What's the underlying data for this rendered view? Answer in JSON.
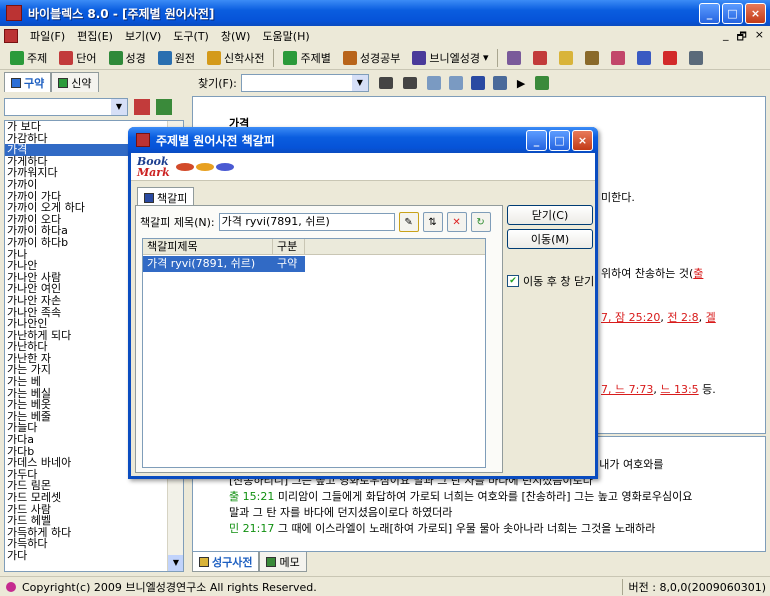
{
  "window": {
    "title": "바이블렉스 8.0 - [주제별 원어사전]"
  },
  "menu": [
    "파일(F)",
    "편집(E)",
    "보기(V)",
    "도구(T)",
    "창(W)",
    "도움말(H)"
  ],
  "mdi": {
    "minimize": "_",
    "restore": "🗗",
    "close": "×"
  },
  "toolbar": {
    "items": [
      "주제",
      "단어",
      "성경",
      "원전",
      "신학사전",
      "주제별",
      "성경공부",
      "브니엘성경"
    ]
  },
  "sidebar": {
    "tabs": [
      "구약",
      "신약"
    ],
    "words": [
      "가 보다",
      "가감하다",
      "가격",
      "가게하다",
      "가까워지다",
      "가까이",
      "가까이 가다",
      "가까이 오게 하다",
      "가까이 오다",
      "가까이 하다a",
      "가까이 하다b",
      "가나",
      "가나안",
      "가나안 사람",
      "가나안 여인",
      "가나안 자손",
      "가나안 족속",
      "가나안인",
      "가난하게 되다",
      "가난하다",
      "가난한 자",
      "가는 가지",
      "가는 베",
      "가는 베실",
      "가는 베옷",
      "가는 베줄",
      "가늘다",
      "가다a",
      "가다b",
      "가데스 바네아",
      "가두다",
      "가드 림몬",
      "가드 모레셋",
      "가드 사람",
      "가드 헤벨",
      "가득하게 하다",
      "가득하다",
      "가다"
    ],
    "selected_index": 2
  },
  "find": {
    "label": "찾기(F):"
  },
  "content": {
    "heading": "가격",
    "fragments": [
      {
        "text": "미한다.",
        "color": "black"
      },
      {
        "text": "위하여 찬송하는 것(",
        "color": "black"
      },
      {
        "text": "출",
        "color": "red"
      },
      {
        "text": "7, ",
        "color": "red"
      },
      {
        "text": "잠 25:20",
        "color": "red"
      },
      {
        "text": ", ",
        "color": "black"
      },
      {
        "text": "전 2:8",
        "color": "red"
      },
      {
        "text": ", ",
        "color": "black"
      },
      {
        "text": "겔",
        "color": "red"
      },
      {
        "text": "7, ",
        "color": "red"
      },
      {
        "text": "느 7:73",
        "color": "red"
      },
      {
        "text": ", ",
        "color": "black"
      },
      {
        "text": "느 13:5",
        "color": "red"
      },
      {
        "text": " 등.",
        "color": "black"
      }
    ]
  },
  "lower": {
    "lines": [
      {
        "ref": "",
        "text": "                                                                                                       불렀으되 내가 여호와를"
      },
      {
        "ref": "출 15:1",
        "text": " 이 때에 모세와 이스라엘 자손이 이 노래로 여호와께 노래하니 일렀으되 내가 여호와를"
      },
      {
        "ref": "",
        "text": "[찬송하리니] 그는 높고 영화로우심이요 말과 그 탄 자를 바다에 던지셨음이로다"
      },
      {
        "ref": "출 15:21",
        "text": " 미리암이 그들에게 화답하여 가로되 너희는 여호와를 [찬송하라] 그는 높고 영화로우심이요"
      },
      {
        "ref": "",
        "text": "말과 그 탄 자를 바다에 던지셨음이로다 하였더라"
      },
      {
        "ref": "민 21:17",
        "text": " 그 때에 이스라엘이 노래[하여 가로되] 우물 물아 솟아나라 너희는 그것을 노래하라"
      }
    ]
  },
  "bottom_tabs": [
    "성구사전",
    "메모"
  ],
  "status": {
    "left": "Copyright(c) 2009 브니엘성경연구소 All rights Reserved.",
    "right": "버전 : 8,0,0(2009060301)"
  },
  "dialog": {
    "title": "주제별 원어사전 책갈피",
    "logo_line1": "Book",
    "logo_line2": "Mark",
    "tab": "책갈피",
    "title_label": "책갈피 제목(N):",
    "title_value": "가격 ryvi(7891, 쉬르)",
    "columns": [
      "책갈피제목",
      "구분"
    ],
    "rows": [
      {
        "title": "가격 ryvi(7891, 쉬르)",
        "kind": "구약"
      }
    ],
    "close_btn": "닫기(C)",
    "move_btn": "이동(M)",
    "checkbox_label": "이동 후 창 닫기",
    "checked": true
  }
}
